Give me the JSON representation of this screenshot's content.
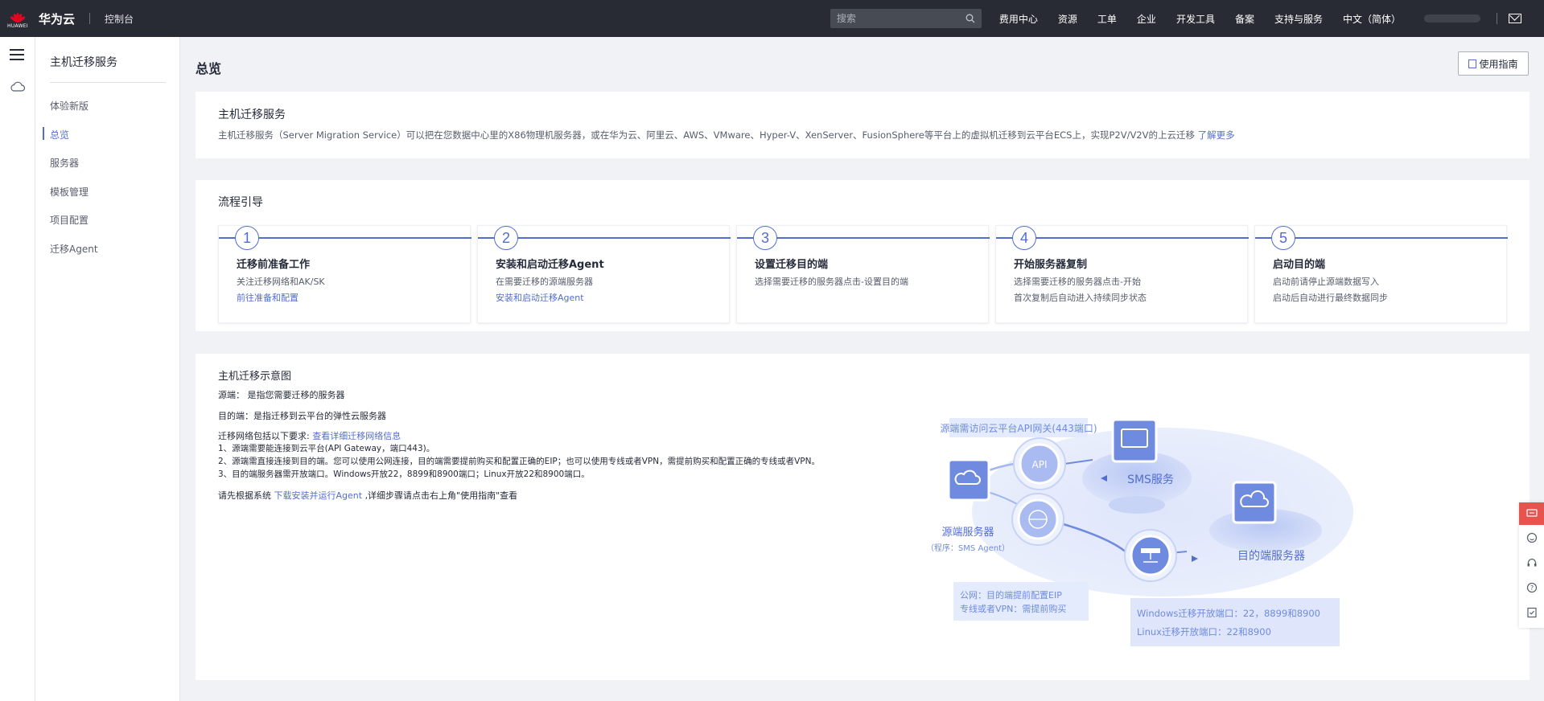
{
  "header": {
    "logo_text": "HUAWEI",
    "brand": "华为云",
    "console": "控制台",
    "search_placeholder": "搜索",
    "nav": [
      "费用中心",
      "资源",
      "工单",
      "企业",
      "开发工具",
      "备案",
      "支持与服务",
      "中文（简体）"
    ]
  },
  "sidebar": {
    "title": "主机迁移服务",
    "items": [
      {
        "label": "体验新版"
      },
      {
        "label": "总览"
      },
      {
        "label": "服务器"
      },
      {
        "label": "模板管理"
      },
      {
        "label": "项目配置"
      },
      {
        "label": "迁移Agent"
      }
    ]
  },
  "page": {
    "title": "总览",
    "guide_button": "使用指南"
  },
  "intro": {
    "title": "主机迁移服务",
    "text": "主机迁移服务（Server Migration Service）可以把在您数据中心里的X86物理机服务器，或在华为云、阿里云、AWS、VMware、Hyper-V、XenServer、FusionSphere等平台上的虚拟机迁移到云平台ECS上，实现P2V/V2V的上云迁移",
    "link": "了解更多"
  },
  "flow": {
    "title": "流程引导",
    "steps": [
      {
        "num": "1",
        "title": "迁移前准备工作",
        "line1": "关注迁移网络和AK/SK",
        "line2": "前往准备和配置",
        "line2_is_link": true
      },
      {
        "num": "2",
        "title": "安装和启动迁移Agent",
        "line1": "在需要迁移的源端服务器",
        "line2": "安装和启动迁移Agent",
        "line2_is_link": true
      },
      {
        "num": "3",
        "title": "设置迁移目的端",
        "line1": "选择需要迁移的服务器点击-设置目的端",
        "line2": "",
        "line2_is_link": false
      },
      {
        "num": "4",
        "title": "开始服务器复制",
        "line1": "选择需要迁移的服务器点击-开始",
        "line2": "首次复制后自动进入持续同步状态",
        "line2_is_link": false
      },
      {
        "num": "5",
        "title": "启动目的端",
        "line1": "启动前请停止源端数据写入",
        "line2": "启动后自动进行最终数据同步",
        "line2_is_link": false
      }
    ]
  },
  "diagram": {
    "title": "主机迁移示意图",
    "source_def": "源端： 是指您需要迁移的服务器",
    "target_def": "目的端：是指迁移到云平台的弹性云服务器",
    "network_intro": "迁移网络包括以下要求:",
    "network_link": "查看详细迁移网络信息",
    "req1": "1、源端需要能连接到云平台(API Gateway，端口443)。",
    "req2": "2、源端需直接连接到目的端。您可以使用公网连接，目的端需要提前购买和配置正确的EIP；也可以使用专线或者VPN，需提前购买和配置正确的专线或者VPN。",
    "req3": "3、目的端服务器需开放端口。Windows开放22，8899和8900端口；Linux开放22和8900端口。",
    "download_prefix": "请先根据系统",
    "download_link": "下载安装并运行Agent",
    "download_suffix": ",详细步骤请点击右上角\"使用指南\"查看",
    "fig": {
      "api_label": "源端需访问云平台API网关(443端口)",
      "api_icon_text": "API",
      "sms_label": "SMS服务",
      "source_label": "源端服务器",
      "source_sub": "（程序：SMS Agent）",
      "target_label": "目的端服务器",
      "net_line1": "公网：目的端提前配置EIP",
      "net_line2": "专线或者VPN：需提前购买",
      "port_line1": "Windows迁移开放端口：22，8899和8900",
      "port_line2": "Linux迁移开放端口：22和8900"
    }
  },
  "colors": {
    "accent": "#526ecc",
    "topbar": "#282b33",
    "float_accent": "#e8534d"
  }
}
